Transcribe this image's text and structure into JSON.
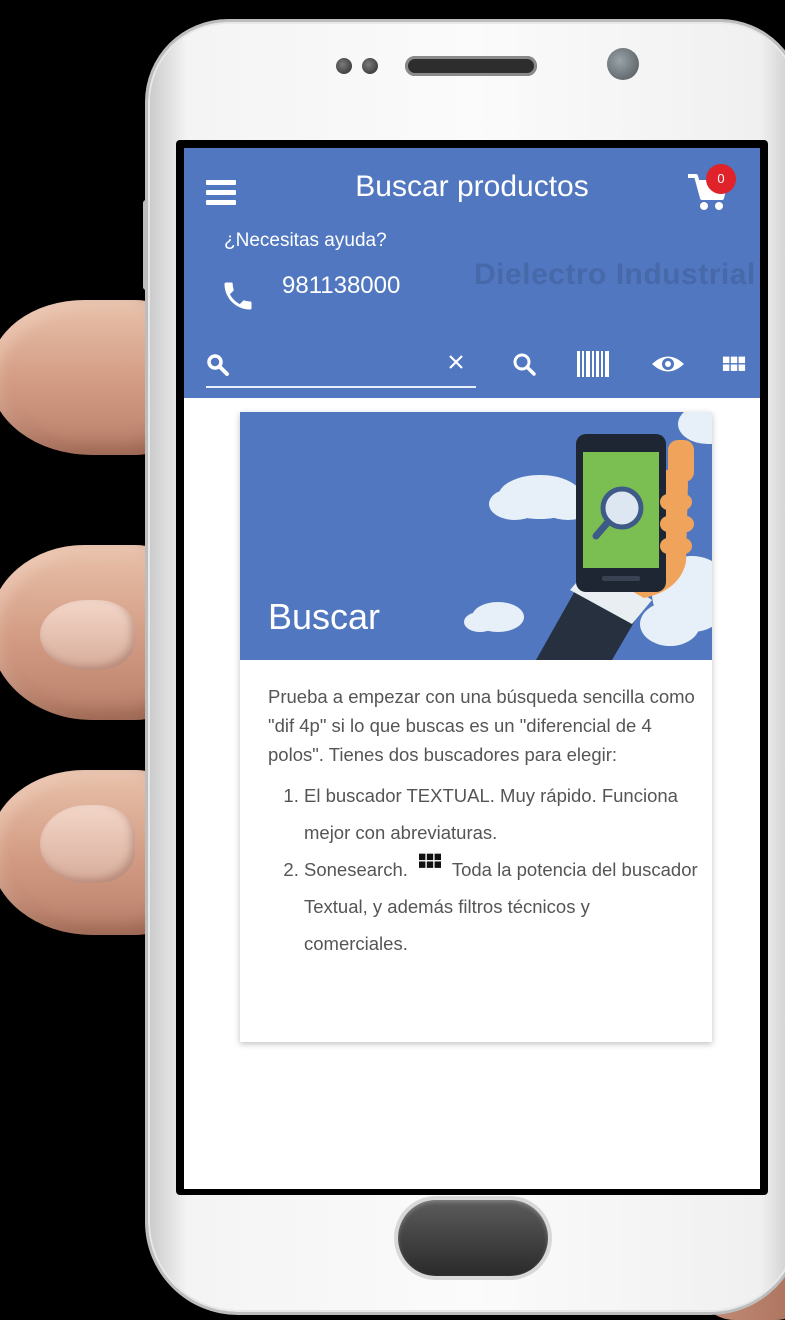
{
  "app": {
    "title": "Buscar productos",
    "cart_count": "0",
    "help_text": "¿Necesitas ayuda?",
    "phone": "981138000",
    "brand_watermark": "Dielectro  Industrial"
  },
  "search": {
    "value": "",
    "placeholder": ""
  },
  "toolbar": {
    "icons": [
      "search-icon",
      "barcode-icon",
      "eye-icon",
      "grid-icon"
    ]
  },
  "card": {
    "banner_title": "Buscar",
    "intro": "Prueba a empezar con una búsqueda sencilla como \"dif 4p\" si lo que buscas es un \"diferencial de 4 polos\". Tienes dos buscadores para elegir:",
    "item1": "El buscador TEXTUAL. Muy rápido. Funciona mejor con abreviaturas.",
    "item2_before": "Sonesearch.",
    "item2_after": "Toda la potencia del buscador Textual, y además filtros técnicos y comerciales."
  },
  "colors": {
    "primary": "#5077bf",
    "badge": "#e0222a",
    "body_text": "#555555"
  }
}
